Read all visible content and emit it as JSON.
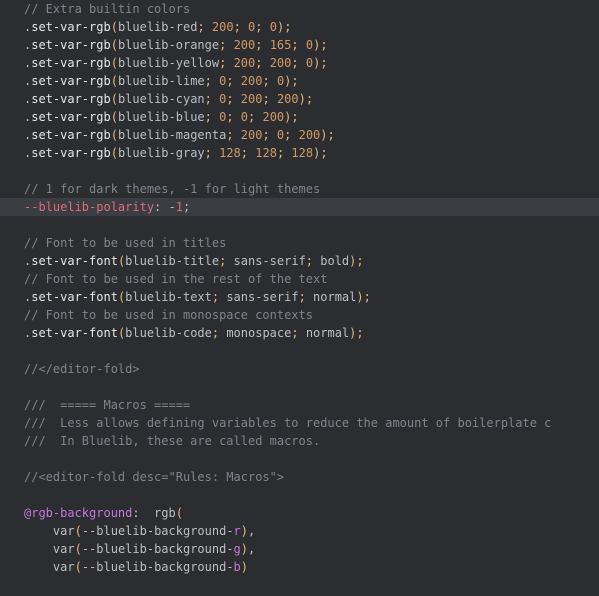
{
  "lines": [
    {
      "cls": "",
      "segments": [
        {
          "t": "// Extra builtin colors",
          "c": "c-comment"
        }
      ]
    },
    {
      "cls": "",
      "segments": [
        {
          "t": ".",
          "c": "c-dot"
        },
        {
          "t": "set-var-rgb",
          "c": "c-mixin"
        },
        {
          "t": "(",
          "c": "c-paren"
        },
        {
          "t": "bluelib-red",
          "c": "c-param"
        },
        {
          "t": "; ",
          "c": "c-semi"
        },
        {
          "t": "200",
          "c": "c-num"
        },
        {
          "t": "; ",
          "c": "c-semi"
        },
        {
          "t": "0",
          "c": "c-num"
        },
        {
          "t": "; ",
          "c": "c-semi"
        },
        {
          "t": "0",
          "c": "c-num"
        },
        {
          "t": ")",
          "c": "c-paren"
        },
        {
          "t": ";",
          "c": "c-semi"
        }
      ]
    },
    {
      "cls": "",
      "segments": [
        {
          "t": ".",
          "c": "c-dot"
        },
        {
          "t": "set-var-rgb",
          "c": "c-mixin"
        },
        {
          "t": "(",
          "c": "c-paren"
        },
        {
          "t": "bluelib-orange",
          "c": "c-param"
        },
        {
          "t": "; ",
          "c": "c-semi"
        },
        {
          "t": "200",
          "c": "c-num"
        },
        {
          "t": "; ",
          "c": "c-semi"
        },
        {
          "t": "165",
          "c": "c-num"
        },
        {
          "t": "; ",
          "c": "c-semi"
        },
        {
          "t": "0",
          "c": "c-num"
        },
        {
          "t": ")",
          "c": "c-paren"
        },
        {
          "t": ";",
          "c": "c-semi"
        }
      ]
    },
    {
      "cls": "",
      "segments": [
        {
          "t": ".",
          "c": "c-dot"
        },
        {
          "t": "set-var-rgb",
          "c": "c-mixin"
        },
        {
          "t": "(",
          "c": "c-paren"
        },
        {
          "t": "bluelib-yellow",
          "c": "c-param"
        },
        {
          "t": "; ",
          "c": "c-semi"
        },
        {
          "t": "200",
          "c": "c-num"
        },
        {
          "t": "; ",
          "c": "c-semi"
        },
        {
          "t": "200",
          "c": "c-num"
        },
        {
          "t": "; ",
          "c": "c-semi"
        },
        {
          "t": "0",
          "c": "c-num"
        },
        {
          "t": ")",
          "c": "c-paren"
        },
        {
          "t": ";",
          "c": "c-semi"
        }
      ]
    },
    {
      "cls": "",
      "segments": [
        {
          "t": ".",
          "c": "c-dot"
        },
        {
          "t": "set-var-rgb",
          "c": "c-mixin"
        },
        {
          "t": "(",
          "c": "c-paren"
        },
        {
          "t": "bluelib-lime",
          "c": "c-param"
        },
        {
          "t": "; ",
          "c": "c-semi"
        },
        {
          "t": "0",
          "c": "c-num"
        },
        {
          "t": "; ",
          "c": "c-semi"
        },
        {
          "t": "200",
          "c": "c-num"
        },
        {
          "t": "; ",
          "c": "c-semi"
        },
        {
          "t": "0",
          "c": "c-num"
        },
        {
          "t": ")",
          "c": "c-paren"
        },
        {
          "t": ";",
          "c": "c-semi"
        }
      ]
    },
    {
      "cls": "",
      "segments": [
        {
          "t": ".",
          "c": "c-dot"
        },
        {
          "t": "set-var-rgb",
          "c": "c-mixin"
        },
        {
          "t": "(",
          "c": "c-paren"
        },
        {
          "t": "bluelib-cyan",
          "c": "c-param"
        },
        {
          "t": "; ",
          "c": "c-semi"
        },
        {
          "t": "0",
          "c": "c-num"
        },
        {
          "t": "; ",
          "c": "c-semi"
        },
        {
          "t": "200",
          "c": "c-num"
        },
        {
          "t": "; ",
          "c": "c-semi"
        },
        {
          "t": "200",
          "c": "c-num"
        },
        {
          "t": ")",
          "c": "c-paren"
        },
        {
          "t": ";",
          "c": "c-semi"
        }
      ]
    },
    {
      "cls": "",
      "segments": [
        {
          "t": ".",
          "c": "c-dot"
        },
        {
          "t": "set-var-rgb",
          "c": "c-mixin"
        },
        {
          "t": "(",
          "c": "c-paren"
        },
        {
          "t": "bluelib-blue",
          "c": "c-param"
        },
        {
          "t": "; ",
          "c": "c-semi"
        },
        {
          "t": "0",
          "c": "c-num"
        },
        {
          "t": "; ",
          "c": "c-semi"
        },
        {
          "t": "0",
          "c": "c-num"
        },
        {
          "t": "; ",
          "c": "c-semi"
        },
        {
          "t": "200",
          "c": "c-num"
        },
        {
          "t": ")",
          "c": "c-paren"
        },
        {
          "t": ";",
          "c": "c-semi"
        }
      ]
    },
    {
      "cls": "",
      "segments": [
        {
          "t": ".",
          "c": "c-dot"
        },
        {
          "t": "set-var-rgb",
          "c": "c-mixin"
        },
        {
          "t": "(",
          "c": "c-paren"
        },
        {
          "t": "bluelib-magenta",
          "c": "c-param"
        },
        {
          "t": "; ",
          "c": "c-semi"
        },
        {
          "t": "200",
          "c": "c-num"
        },
        {
          "t": "; ",
          "c": "c-semi"
        },
        {
          "t": "0",
          "c": "c-num"
        },
        {
          "t": "; ",
          "c": "c-semi"
        },
        {
          "t": "200",
          "c": "c-num"
        },
        {
          "t": ")",
          "c": "c-paren"
        },
        {
          "t": ";",
          "c": "c-semi"
        }
      ]
    },
    {
      "cls": "",
      "segments": [
        {
          "t": ".",
          "c": "c-dot"
        },
        {
          "t": "set-var-rgb",
          "c": "c-mixin"
        },
        {
          "t": "(",
          "c": "c-paren"
        },
        {
          "t": "bluelib-gray",
          "c": "c-param"
        },
        {
          "t": "; ",
          "c": "c-semi"
        },
        {
          "t": "128",
          "c": "c-num"
        },
        {
          "t": "; ",
          "c": "c-semi"
        },
        {
          "t": "128",
          "c": "c-num"
        },
        {
          "t": "; ",
          "c": "c-semi"
        },
        {
          "t": "128",
          "c": "c-num"
        },
        {
          "t": ")",
          "c": "c-paren"
        },
        {
          "t": ";",
          "c": "c-semi"
        }
      ]
    },
    {
      "cls": "",
      "segments": [
        {
          "t": "",
          "c": ""
        }
      ]
    },
    {
      "cls": "",
      "segments": [
        {
          "t": "// 1 for dark themes, -1 for light themes",
          "c": "c-comment"
        }
      ]
    },
    {
      "cls": "highlight-line",
      "segments": [
        {
          "t": "--bluelib-polarity",
          "c": "c-varname"
        },
        {
          "t": ": ",
          "c": "c-punc"
        },
        {
          "t": "-",
          "c": "c-punc"
        },
        {
          "t": "1",
          "c": "c-negnum"
        },
        {
          "t": ";",
          "c": "c-punc"
        }
      ]
    },
    {
      "cls": "",
      "segments": [
        {
          "t": "",
          "c": ""
        }
      ]
    },
    {
      "cls": "",
      "segments": [
        {
          "t": "// Font to be used in titles",
          "c": "c-comment"
        }
      ]
    },
    {
      "cls": "",
      "segments": [
        {
          "t": ".",
          "c": "c-dot"
        },
        {
          "t": "set-var-font",
          "c": "c-mixin"
        },
        {
          "t": "(",
          "c": "c-paren"
        },
        {
          "t": "bluelib-title",
          "c": "c-param"
        },
        {
          "t": "; ",
          "c": "c-semi"
        },
        {
          "t": "sans-serif",
          "c": "c-param"
        },
        {
          "t": "; ",
          "c": "c-semi"
        },
        {
          "t": "bold",
          "c": "c-param"
        },
        {
          "t": ")",
          "c": "c-paren"
        },
        {
          "t": ";",
          "c": "c-semi"
        }
      ]
    },
    {
      "cls": "",
      "segments": [
        {
          "t": "// Font to be used in the rest of the text",
          "c": "c-comment"
        }
      ]
    },
    {
      "cls": "",
      "segments": [
        {
          "t": ".",
          "c": "c-dot"
        },
        {
          "t": "set-var-font",
          "c": "c-mixin"
        },
        {
          "t": "(",
          "c": "c-paren"
        },
        {
          "t": "bluelib-text",
          "c": "c-param"
        },
        {
          "t": "; ",
          "c": "c-semi"
        },
        {
          "t": "sans-serif",
          "c": "c-param"
        },
        {
          "t": "; ",
          "c": "c-semi"
        },
        {
          "t": "normal",
          "c": "c-param"
        },
        {
          "t": ")",
          "c": "c-paren"
        },
        {
          "t": ";",
          "c": "c-semi"
        }
      ]
    },
    {
      "cls": "",
      "segments": [
        {
          "t": "// Font to be used in monospace contexts",
          "c": "c-comment"
        }
      ]
    },
    {
      "cls": "",
      "segments": [
        {
          "t": ".",
          "c": "c-dot"
        },
        {
          "t": "set-var-font",
          "c": "c-mixin"
        },
        {
          "t": "(",
          "c": "c-paren"
        },
        {
          "t": "bluelib-code",
          "c": "c-param"
        },
        {
          "t": "; ",
          "c": "c-semi"
        },
        {
          "t": "monospace",
          "c": "c-param"
        },
        {
          "t": "; ",
          "c": "c-semi"
        },
        {
          "t": "normal",
          "c": "c-param"
        },
        {
          "t": ")",
          "c": "c-paren"
        },
        {
          "t": ";",
          "c": "c-semi"
        }
      ]
    },
    {
      "cls": "",
      "segments": [
        {
          "t": "",
          "c": ""
        }
      ]
    },
    {
      "cls": "",
      "segments": [
        {
          "t": "//",
          "c": "c-comment"
        },
        {
          "t": "</editor-fold>",
          "c": "c-comment"
        }
      ]
    },
    {
      "cls": "",
      "segments": [
        {
          "t": "",
          "c": ""
        }
      ]
    },
    {
      "cls": "",
      "segments": [
        {
          "t": "///  ===== Macros =====",
          "c": "c-comment"
        }
      ]
    },
    {
      "cls": "",
      "segments": [
        {
          "t": "///  Less allows defining variables to reduce the amount of boilerplate c",
          "c": "c-comment"
        }
      ]
    },
    {
      "cls": "",
      "segments": [
        {
          "t": "///  In Bluelib, these are called macros.",
          "c": "c-comment"
        }
      ]
    },
    {
      "cls": "",
      "segments": [
        {
          "t": "",
          "c": ""
        }
      ]
    },
    {
      "cls": "",
      "segments": [
        {
          "t": "//",
          "c": "c-comment"
        },
        {
          "t": "<editor-fold desc=\"Rules: Macros\">",
          "c": "c-comment"
        }
      ]
    },
    {
      "cls": "",
      "segments": [
        {
          "t": "",
          "c": ""
        }
      ]
    },
    {
      "cls": "",
      "segments": [
        {
          "t": "@rgb-background",
          "c": "c-atkw"
        },
        {
          "t": ": ",
          "c": "c-punc"
        },
        {
          "t": " rgb",
          "c": "c-rgbfunc"
        },
        {
          "t": "(",
          "c": "c-paren"
        }
      ]
    },
    {
      "cls": "",
      "segments": [
        {
          "t": "    ",
          "c": ""
        },
        {
          "t": "var",
          "c": "c-rgbfunc"
        },
        {
          "t": "(",
          "c": "c-paren"
        },
        {
          "t": "--bluelib-background-",
          "c": "c-param"
        },
        {
          "t": "r",
          "c": "c-suffix"
        },
        {
          "t": ")",
          "c": "c-paren"
        },
        {
          "t": ",",
          "c": "c-punc"
        }
      ]
    },
    {
      "cls": "",
      "segments": [
        {
          "t": "    ",
          "c": ""
        },
        {
          "t": "var",
          "c": "c-rgbfunc"
        },
        {
          "t": "(",
          "c": "c-paren"
        },
        {
          "t": "--bluelib-background-",
          "c": "c-param"
        },
        {
          "t": "g",
          "c": "c-suffix"
        },
        {
          "t": ")",
          "c": "c-paren"
        },
        {
          "t": ",",
          "c": "c-punc"
        }
      ]
    },
    {
      "cls": "",
      "segments": [
        {
          "t": "    ",
          "c": ""
        },
        {
          "t": "var",
          "c": "c-rgbfunc"
        },
        {
          "t": "(",
          "c": "c-paren"
        },
        {
          "t": "--bluelib-background-",
          "c": "c-param"
        },
        {
          "t": "b",
          "c": "c-suffix"
        },
        {
          "t": ")",
          "c": "c-paren"
        }
      ]
    }
  ]
}
